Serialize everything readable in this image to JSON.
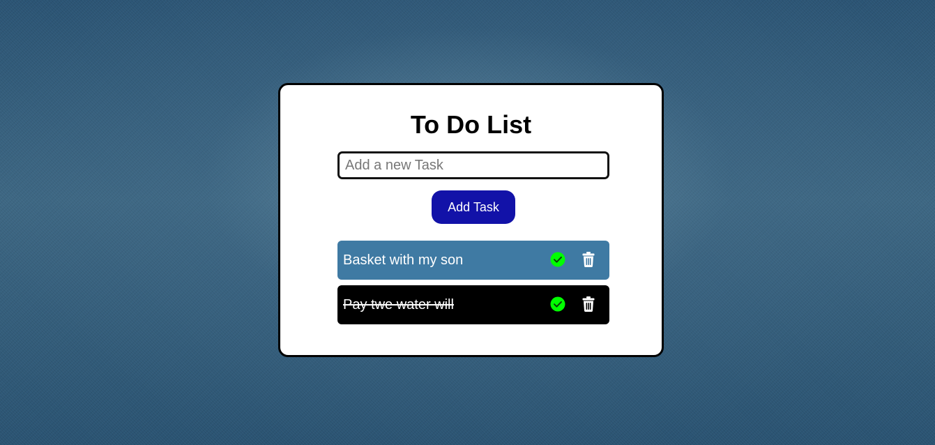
{
  "app": {
    "title": "To Do List"
  },
  "input": {
    "value": "",
    "placeholder": "Add a new Task"
  },
  "add_button": {
    "label": "Add Task"
  },
  "tasks": [
    {
      "text": "Basket with my son",
      "completed": false,
      "background": "#3f7aa3"
    },
    {
      "text": "Pay twe water will",
      "completed": true,
      "background": "#000000"
    }
  ],
  "icons": {
    "complete": "check-circle-icon",
    "delete": "trash-icon"
  },
  "colors": {
    "accent": "#1212a8",
    "check": "#00ff00",
    "card": "#ffffff"
  }
}
